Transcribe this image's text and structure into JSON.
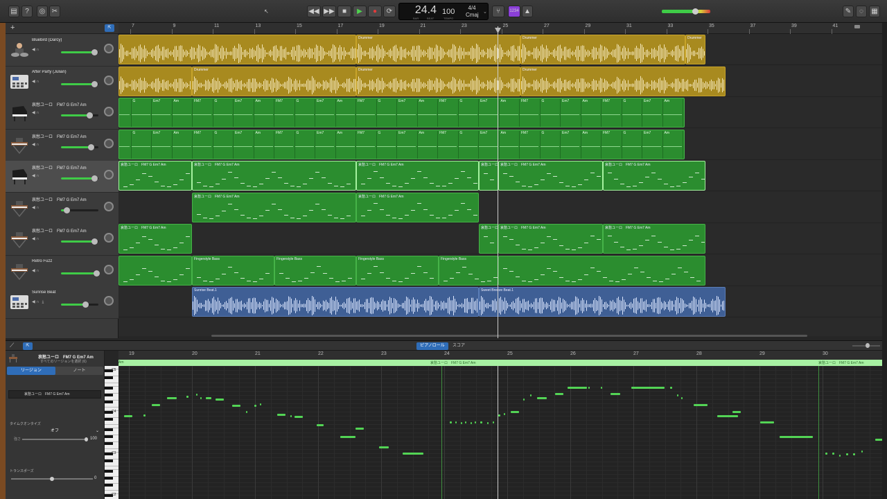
{
  "toolbar": {
    "lcd_position": "24.4",
    "lcd_bar_label": "BAR",
    "lcd_beat_label": "BEAT",
    "lcd_tempo": "100",
    "lcd_tempo_label": "TEMPO",
    "lcd_sig": "4/4",
    "lcd_key": "Cmaj",
    "count_in": "1234"
  },
  "ruler": [
    "7",
    "9",
    "11",
    "13",
    "15",
    "17",
    "19",
    "21",
    "23",
    "25",
    "27",
    "29",
    "31",
    "33",
    "35",
    "37",
    "39",
    "41"
  ],
  "tracks": [
    {
      "name": "Bluebird (Darcy)",
      "icon": "drummer-icon",
      "vol": 0.88
    },
    {
      "name": "After Party (Julian)",
      "icon": "drum-machine-icon",
      "vol": 0.88
    },
    {
      "name": "哀愁ユーロ　FM7 G Em7 Am",
      "icon": "grand-piano-icon",
      "vol": 0.75
    },
    {
      "name": "哀愁ユーロ　FM7 G Em7 Am",
      "icon": "keyboard-icon",
      "vol": 0.8
    },
    {
      "name": "哀愁ユーロ　FM7 G Em7 Am",
      "icon": "grand-piano-icon",
      "vol": 0.88
    },
    {
      "name": "哀愁ユーロ　FM7 G Em7 Am",
      "icon": "keyboard-icon",
      "vol": 0.15
    },
    {
      "name": "哀愁ユーロ　FM7 G Em7 Am",
      "icon": "keyboard-icon",
      "vol": 0.88
    },
    {
      "name": "Retro Fuzz",
      "icon": "keyboard-icon",
      "vol": 0.95
    },
    {
      "name": "Sunrise Beat",
      "icon": "drum-machine-icon",
      "vol": 0.65
    }
  ],
  "regions": {
    "drummer": "Drummer",
    "piano_a": "哀愁ユーロ　FM7 G Em7 Am",
    "piano_a_short": "哀愁ユーロ　FM7 G Em7 Am",
    "bass": "Fingerstyle Bass",
    "beat1": "Sunrise Beat.1",
    "beat2": "Sweet Breeze Beat.1",
    "chords": [
      "FM7",
      "G",
      "Em7",
      "Am"
    ]
  },
  "editor": {
    "tab_pianoroll": "ピアノロール",
    "tab_score": "スコア",
    "region_title": "哀愁ユーロ　FM7 G Em7 Am",
    "region_sub": "すべてのリージョンを選択 (6)",
    "tab_region": "リージョン",
    "tab_note": "ノート",
    "region_name_field": "哀愁ユーロ　FM7 G Em7 Am",
    "quantize_label": "タイムクオンタイズ",
    "quantize_value": "オフ",
    "strength_label": "強さ",
    "strength_value": "100",
    "transpose_label": "トランスポーズ",
    "transpose_value": "0",
    "ruler": [
      "19",
      "20",
      "21",
      "22",
      "23",
      "24",
      "25",
      "26",
      "27",
      "28",
      "29",
      "30"
    ],
    "region_strip": "哀愁ユーロ　FM7 G Em7 Am",
    "octaves": [
      "C5",
      "C4",
      "C3",
      "C2"
    ]
  }
}
